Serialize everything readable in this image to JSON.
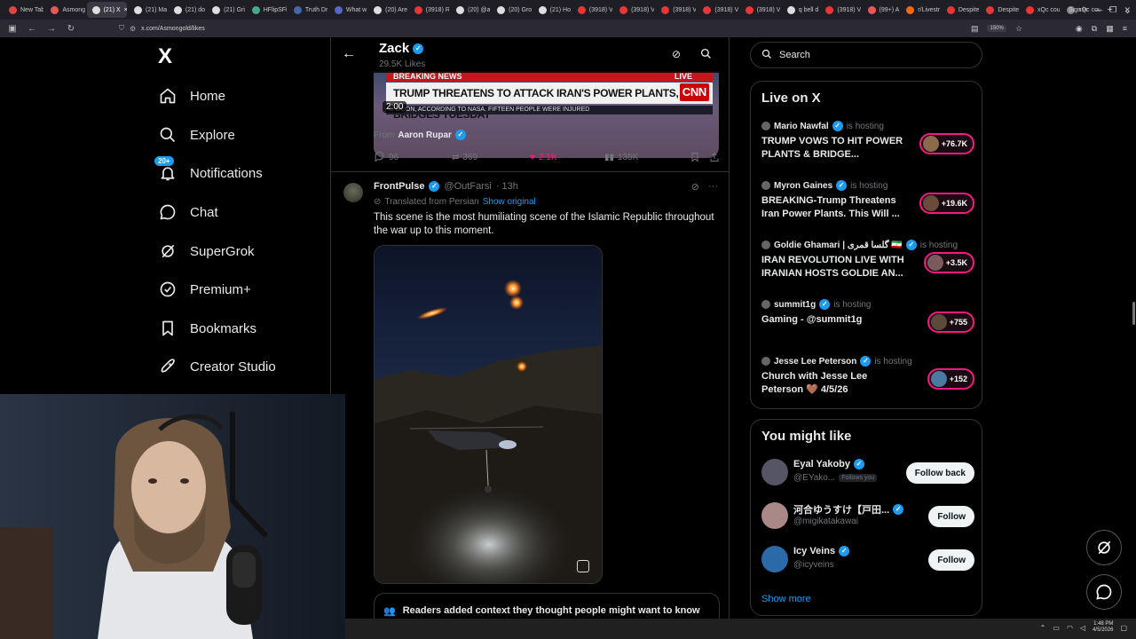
{
  "browser": {
    "tabs": [
      {
        "label": "New Tab",
        "color": "#e0443e"
      },
      {
        "label": "Asmong",
        "color": "#e55"
      },
      {
        "label": "(21) X",
        "color": "#ddd"
      },
      {
        "label": "(21) Ma",
        "color": "#ddd"
      },
      {
        "label": "(21) do",
        "color": "#ddd"
      },
      {
        "label": "(21) Gri",
        "color": "#ddd"
      },
      {
        "label": "HFlipSFi",
        "color": "#4a8"
      },
      {
        "label": "Truth Dr",
        "color": "#46a"
      },
      {
        "label": "What w",
        "color": "#56c"
      },
      {
        "label": "(20) Are",
        "color": "#ddd"
      },
      {
        "label": "(3918) R",
        "color": "#e33"
      },
      {
        "label": "(20) @a",
        "color": "#ddd"
      },
      {
        "label": "(20) Gro",
        "color": "#ddd"
      },
      {
        "label": "(21) Ho",
        "color": "#ddd"
      },
      {
        "label": "(3918) V",
        "color": "#e33"
      },
      {
        "label": "(3918) V",
        "color": "#e33"
      },
      {
        "label": "(3918) V",
        "color": "#e33"
      },
      {
        "label": "(3918) V",
        "color": "#e33"
      },
      {
        "label": "(3918) V",
        "color": "#e33"
      },
      {
        "label": "q bell d",
        "color": "#ddd"
      },
      {
        "label": "(3918) V",
        "color": "#e33"
      },
      {
        "label": "(99+) A",
        "color": "#e55"
      },
      {
        "label": "r/Livestr",
        "color": "#f60"
      },
      {
        "label": "Despite",
        "color": "#e33"
      },
      {
        "label": "Despite",
        "color": "#e33"
      },
      {
        "label": "xQc cou",
        "color": "#e33"
      },
      {
        "label": "xQc cou",
        "color": "#888"
      }
    ],
    "active_tab_index": 2,
    "url": "x.com/Asmongold/likes",
    "zoom": "150%",
    "sign_in": "Sign in"
  },
  "sidebar": {
    "logo": "X",
    "notifications_badge": "20+",
    "items": [
      {
        "label": "Home",
        "icon": "home-icon"
      },
      {
        "label": "Explore",
        "icon": "search-icon"
      },
      {
        "label": "Notifications",
        "icon": "bell-icon"
      },
      {
        "label": "Chat",
        "icon": "chat-icon"
      },
      {
        "label": "SuperGrok",
        "icon": "grok-icon"
      },
      {
        "label": "Premium+",
        "icon": "premium-icon"
      },
      {
        "label": "Bookmarks",
        "icon": "bookmark-icon"
      },
      {
        "label": "Creator Studio",
        "icon": "rocket-icon"
      }
    ]
  },
  "header": {
    "name": "Zack",
    "likes": "29.5K Likes"
  },
  "tweet1": {
    "video": {
      "breaking": "BREAKING NEWS",
      "live": "LIVE",
      "headline": "TRUMP THREATENS TO ATTACK IRAN'S POWER PLANTS, BRIDGES TUESDAY",
      "network": "CNN",
      "ticker": "E MOON, ACCORDING TO NASA.  FIFTEEN PEOPLE WERE INJURED",
      "duration": "2:00"
    },
    "from_prefix": "From",
    "from_name": "Aaron Rupar",
    "replies": "96",
    "reposts": "369",
    "likes": "2.1K",
    "views": "135K"
  },
  "tweet2": {
    "name": "FrontPulse",
    "handle": "@OutFarsi",
    "time": "· 13h",
    "translated": "Translated from Persian",
    "show_original": "Show original",
    "text": "This scene is the most humiliating scene of the Islamic Republic throughout the war up to this moment.",
    "note": "Readers added context they thought people might want to know"
  },
  "search": {
    "placeholder": "Search"
  },
  "live": {
    "title": "Live on X",
    "hosting": "is hosting",
    "items": [
      {
        "host": "Mario Nawfal",
        "title": "TRUMP VOWS TO HIT POWER PLANTS & BRIDGE...",
        "count": "+76.7K",
        "color": "#8a6a4a"
      },
      {
        "host": "Myron Gaines",
        "title": "BREAKING-Trump Threatens Iran Power Plants. This Will ...",
        "count": "+19.6K",
        "color": "#6a4a3a"
      },
      {
        "host": "Goldie Ghamari | گلسا قمری 🇮🇷",
        "title": "IRAN REVOLUTION LIVE WITH IRANIAN HOSTS GOLDIE AN...",
        "count": "+3.5K",
        "color": "#7a5a5a"
      },
      {
        "host": "summit1g",
        "title": "Gaming - @summit1g",
        "count": "+755",
        "color": "#5a4a3a"
      },
      {
        "host": "Jesse Lee Peterson",
        "title": "Church with Jesse Lee Peterson 🤎 4/5/26",
        "count": "+152",
        "color": "#4a7aa0"
      }
    ]
  },
  "suggestions": {
    "title": "You might like",
    "follows_you": "Follows you",
    "show_more": "Show more",
    "items": [
      {
        "name": "Eyal Yakoby",
        "handle": "@EYako...",
        "button": "Follow back",
        "color": "#556"
      },
      {
        "name": "河合ゆうすけ【戸田...",
        "handle": "@migikatakawai",
        "button": "Follow",
        "color": "#a88"
      },
      {
        "name": "Icy Veins",
        "handle": "@icyveins",
        "button": "Follow",
        "color": "#2a6aa8"
      }
    ]
  },
  "taskbar": {
    "time": "1:48 PM",
    "date": "4/5/2026"
  }
}
